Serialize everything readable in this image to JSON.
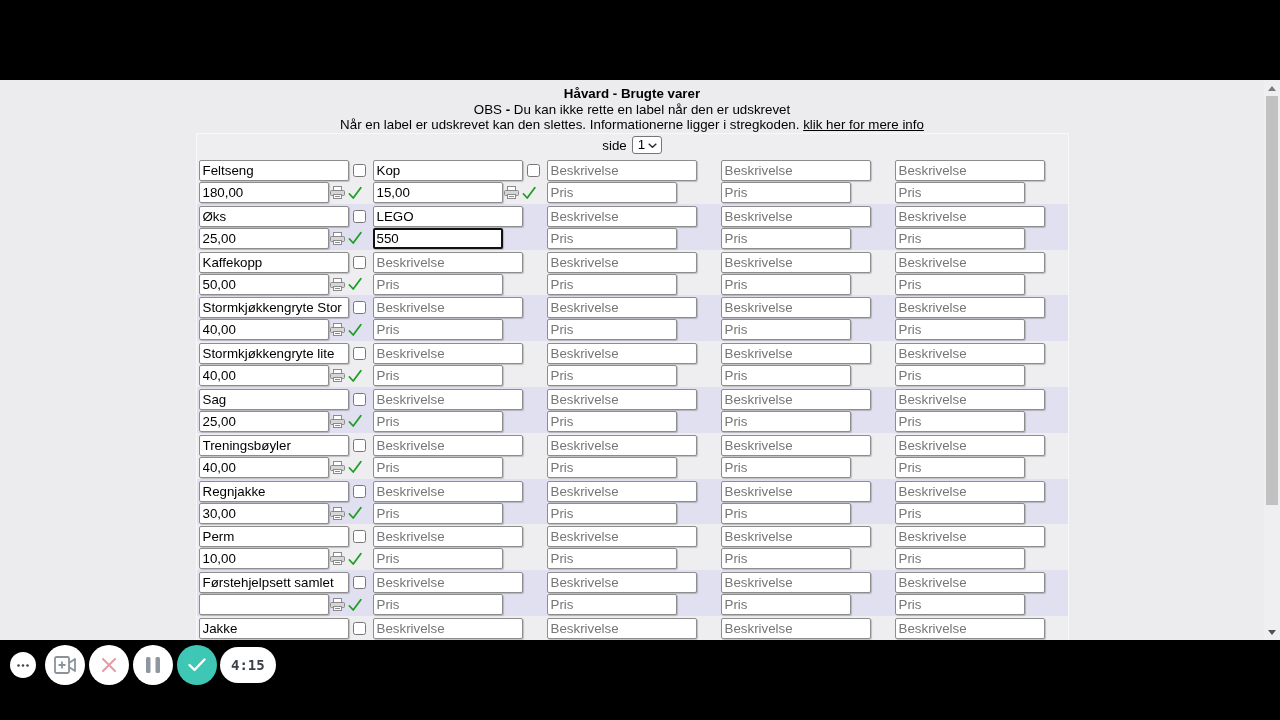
{
  "header": {
    "title": "Håvard - Brugte varer",
    "notice": "OBS **-** Du kan ikke rette en label når den er udskrevet",
    "info": "Når en label er udskrevet kan den slettes. Informationerne ligger i stregkoden.",
    "info_link": "klik her for mere info"
  },
  "pager": {
    "label": "side",
    "value": "1"
  },
  "rows": [
    {
      "cells": [
        {
          "kind": "saved",
          "description": {
            "value": "Feltseng"
          },
          "price": {
            "value": "180,00"
          },
          "checked": false,
          "printed": true
        },
        {
          "kind": "saved",
          "description": {
            "value": "Kop"
          },
          "price": {
            "value": "15,00"
          },
          "checked": false,
          "printed": true
        },
        {
          "kind": "empty",
          "description": {
            "placeholder": "Beskrivelse"
          },
          "price": {
            "placeholder": "Pris"
          }
        },
        {
          "kind": "empty",
          "description": {
            "placeholder": "Beskrivelse"
          },
          "price": {
            "placeholder": "Pris"
          }
        },
        {
          "kind": "empty",
          "description": {
            "placeholder": "Beskrivelse"
          },
          "price": {
            "placeholder": "Pris"
          }
        }
      ]
    },
    {
      "cells": [
        {
          "kind": "saved",
          "description": {
            "value": "Øks"
          },
          "price": {
            "value": "25,00"
          },
          "checked": false,
          "printed": true
        },
        {
          "kind": "editing",
          "description": {
            "value": "LEGO"
          },
          "price": {
            "value": "550"
          }
        },
        {
          "kind": "empty",
          "description": {
            "placeholder": "Beskrivelse"
          },
          "price": {
            "placeholder": "Pris"
          }
        },
        {
          "kind": "empty",
          "description": {
            "placeholder": "Beskrivelse"
          },
          "price": {
            "placeholder": "Pris"
          }
        },
        {
          "kind": "empty",
          "description": {
            "placeholder": "Beskrivelse"
          },
          "price": {
            "placeholder": "Pris"
          }
        }
      ]
    },
    {
      "cells": [
        {
          "kind": "saved",
          "description": {
            "value": "Kaffekopp"
          },
          "price": {
            "value": "50,00"
          },
          "checked": false,
          "printed": true
        },
        {
          "kind": "empty",
          "description": {
            "placeholder": "Beskrivelse"
          },
          "price": {
            "placeholder": "Pris"
          }
        },
        {
          "kind": "empty",
          "description": {
            "placeholder": "Beskrivelse"
          },
          "price": {
            "placeholder": "Pris"
          }
        },
        {
          "kind": "empty",
          "description": {
            "placeholder": "Beskrivelse"
          },
          "price": {
            "placeholder": "Pris"
          }
        },
        {
          "kind": "empty",
          "description": {
            "placeholder": "Beskrivelse"
          },
          "price": {
            "placeholder": "Pris"
          }
        }
      ]
    },
    {
      "cells": [
        {
          "kind": "saved",
          "description": {
            "value": "Stormkjøkkengryte Stor"
          },
          "price": {
            "value": "40,00"
          },
          "checked": false,
          "printed": true
        },
        {
          "kind": "empty",
          "description": {
            "placeholder": "Beskrivelse"
          },
          "price": {
            "placeholder": "Pris"
          }
        },
        {
          "kind": "empty",
          "description": {
            "placeholder": "Beskrivelse"
          },
          "price": {
            "placeholder": "Pris"
          }
        },
        {
          "kind": "empty",
          "description": {
            "placeholder": "Beskrivelse"
          },
          "price": {
            "placeholder": "Pris"
          }
        },
        {
          "kind": "empty",
          "description": {
            "placeholder": "Beskrivelse"
          },
          "price": {
            "placeholder": "Pris"
          }
        }
      ]
    },
    {
      "cells": [
        {
          "kind": "saved",
          "description": {
            "value": "Stormkjøkkengryte lite"
          },
          "price": {
            "value": "40,00"
          },
          "checked": false,
          "printed": true
        },
        {
          "kind": "empty",
          "description": {
            "placeholder": "Beskrivelse"
          },
          "price": {
            "placeholder": "Pris"
          }
        },
        {
          "kind": "empty",
          "description": {
            "placeholder": "Beskrivelse"
          },
          "price": {
            "placeholder": "Pris"
          }
        },
        {
          "kind": "empty",
          "description": {
            "placeholder": "Beskrivelse"
          },
          "price": {
            "placeholder": "Pris"
          }
        },
        {
          "kind": "empty",
          "description": {
            "placeholder": "Beskrivelse"
          },
          "price": {
            "placeholder": "Pris"
          }
        }
      ]
    },
    {
      "cells": [
        {
          "kind": "saved",
          "description": {
            "value": "Sag"
          },
          "price": {
            "value": "25,00"
          },
          "checked": false,
          "printed": true
        },
        {
          "kind": "empty",
          "description": {
            "placeholder": "Beskrivelse"
          },
          "price": {
            "placeholder": "Pris"
          }
        },
        {
          "kind": "empty",
          "description": {
            "placeholder": "Beskrivelse"
          },
          "price": {
            "placeholder": "Pris"
          }
        },
        {
          "kind": "empty",
          "description": {
            "placeholder": "Beskrivelse"
          },
          "price": {
            "placeholder": "Pris"
          }
        },
        {
          "kind": "empty",
          "description": {
            "placeholder": "Beskrivelse"
          },
          "price": {
            "placeholder": "Pris"
          }
        }
      ]
    },
    {
      "cells": [
        {
          "kind": "saved",
          "description": {
            "value": "Treningsbøyler"
          },
          "price": {
            "value": "40,00"
          },
          "checked": false,
          "printed": true
        },
        {
          "kind": "empty",
          "description": {
            "placeholder": "Beskrivelse"
          },
          "price": {
            "placeholder": "Pris"
          }
        },
        {
          "kind": "empty",
          "description": {
            "placeholder": "Beskrivelse"
          },
          "price": {
            "placeholder": "Pris"
          }
        },
        {
          "kind": "empty",
          "description": {
            "placeholder": "Beskrivelse"
          },
          "price": {
            "placeholder": "Pris"
          }
        },
        {
          "kind": "empty",
          "description": {
            "placeholder": "Beskrivelse"
          },
          "price": {
            "placeholder": "Pris"
          }
        }
      ]
    },
    {
      "cells": [
        {
          "kind": "saved",
          "description": {
            "value": "Regnjakke"
          },
          "price": {
            "value": "30,00"
          },
          "checked": false,
          "printed": true
        },
        {
          "kind": "empty",
          "description": {
            "placeholder": "Beskrivelse"
          },
          "price": {
            "placeholder": "Pris"
          }
        },
        {
          "kind": "empty",
          "description": {
            "placeholder": "Beskrivelse"
          },
          "price": {
            "placeholder": "Pris"
          }
        },
        {
          "kind": "empty",
          "description": {
            "placeholder": "Beskrivelse"
          },
          "price": {
            "placeholder": "Pris"
          }
        },
        {
          "kind": "empty",
          "description": {
            "placeholder": "Beskrivelse"
          },
          "price": {
            "placeholder": "Pris"
          }
        }
      ]
    },
    {
      "cells": [
        {
          "kind": "saved",
          "description": {
            "value": "Perm"
          },
          "price": {
            "value": "10,00"
          },
          "checked": false,
          "printed": true
        },
        {
          "kind": "empty",
          "description": {
            "placeholder": "Beskrivelse"
          },
          "price": {
            "placeholder": "Pris"
          }
        },
        {
          "kind": "empty",
          "description": {
            "placeholder": "Beskrivelse"
          },
          "price": {
            "placeholder": "Pris"
          }
        },
        {
          "kind": "empty",
          "description": {
            "placeholder": "Beskrivelse"
          },
          "price": {
            "placeholder": "Pris"
          }
        },
        {
          "kind": "empty",
          "description": {
            "placeholder": "Beskrivelse"
          },
          "price": {
            "placeholder": "Pris"
          }
        }
      ]
    },
    {
      "cells": [
        {
          "kind": "saved",
          "description": {
            "value": "Førstehjelpsett samlet"
          },
          "checked": false,
          "printed": true
        },
        {
          "kind": "empty",
          "description": {
            "placeholder": "Beskrivelse"
          },
          "price": {
            "placeholder": "Pris"
          }
        },
        {
          "kind": "empty",
          "description": {
            "placeholder": "Beskrivelse"
          },
          "price": {
            "placeholder": "Pris"
          }
        },
        {
          "kind": "empty",
          "description": {
            "placeholder": "Beskrivelse"
          },
          "price": {
            "placeholder": "Pris"
          }
        },
        {
          "kind": "empty",
          "description": {
            "placeholder": "Beskrivelse"
          },
          "price": {
            "placeholder": "Pris"
          }
        }
      ]
    },
    {
      "cells": [
        {
          "kind": "saved",
          "description": {
            "value": "Jakke"
          },
          "checked": false
        },
        {
          "kind": "empty",
          "description": {
            "placeholder": "Beskrivelse"
          }
        },
        {
          "kind": "empty",
          "description": {
            "placeholder": "Beskrivelse"
          }
        },
        {
          "kind": "empty",
          "description": {
            "placeholder": "Beskrivelse"
          }
        },
        {
          "kind": "empty",
          "description": {
            "placeholder": "Beskrivelse"
          }
        }
      ]
    }
  ],
  "recorder": {
    "timer": "4:15"
  }
}
